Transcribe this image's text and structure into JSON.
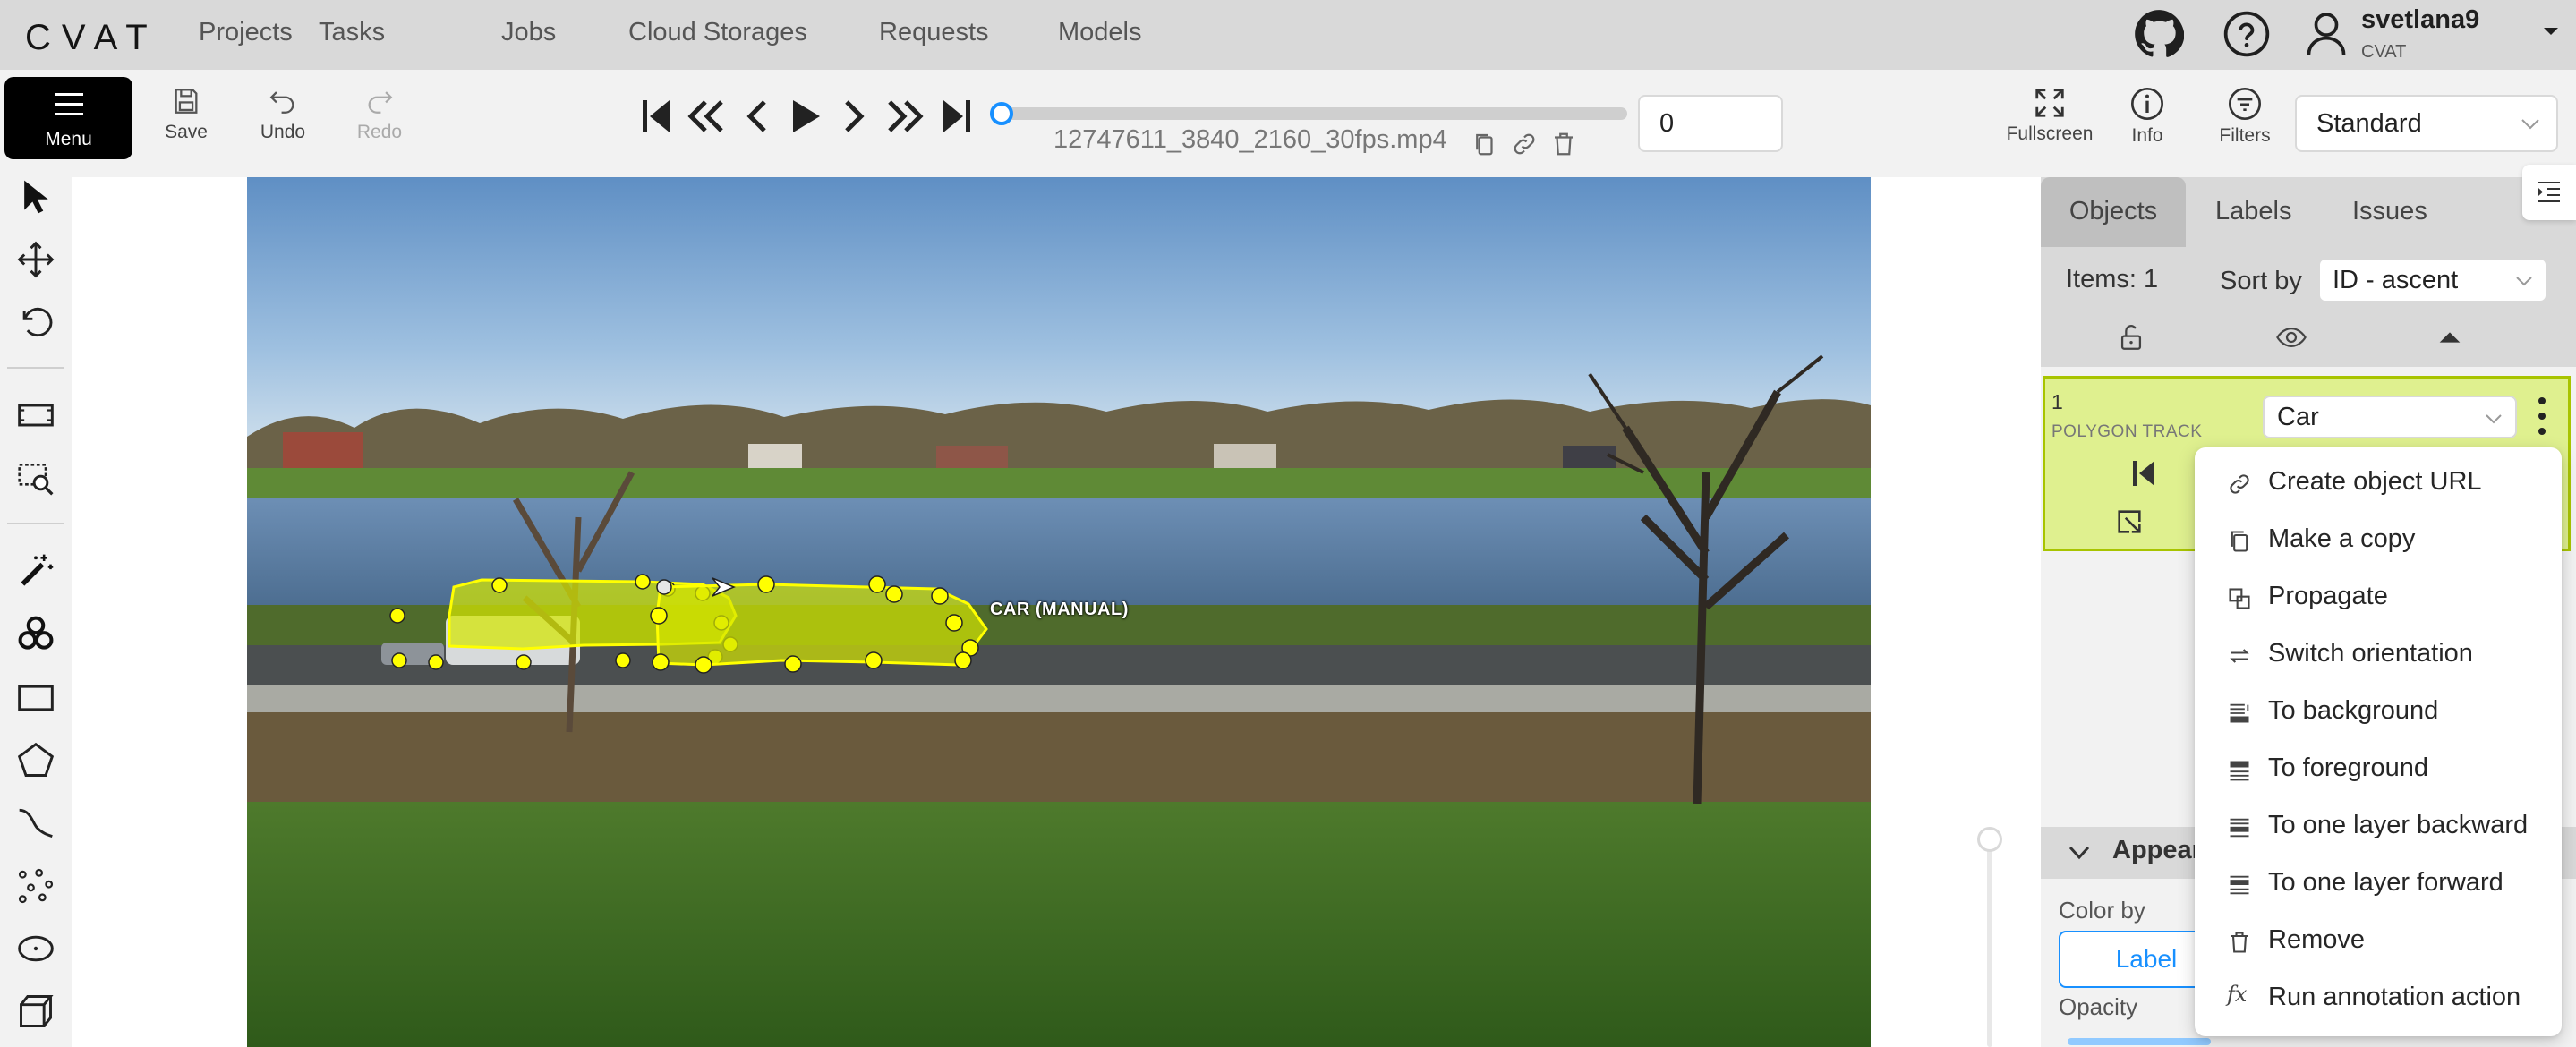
{
  "app": {
    "logo": "CVAT",
    "nav": [
      "Projects",
      "Tasks",
      "Jobs",
      "Cloud Storages",
      "Requests",
      "Models"
    ],
    "user": {
      "name": "svetlana9",
      "org": "CVAT"
    }
  },
  "toolbar": {
    "menu_label": "Menu",
    "save_label": "Save",
    "undo_label": "Undo",
    "redo_label": "Redo",
    "filename": "12747611_3840_2160_30fps.mp4",
    "frame_value": "0",
    "fullscreen_label": "Fullscreen",
    "info_label": "Info",
    "filters_label": "Filters",
    "workspace": "Standard"
  },
  "canvas": {
    "shape_label": "CAR (MANUAL)"
  },
  "sidebar": {
    "tabs": [
      "Objects",
      "Labels",
      "Issues"
    ],
    "items_count": "Items: 1",
    "sort_by_label": "Sort by",
    "sort_by_value": "ID - ascent",
    "object": {
      "id": "1",
      "type": "POLYGON TRACK",
      "label": "Car",
      "color": "#dff08f"
    },
    "appearance": {
      "title": "Appearance",
      "color_by_label": "Color by",
      "color_by_value": "Label",
      "opacity_label": "Opacity"
    }
  },
  "context_menu": {
    "items": [
      {
        "label": "Create object URL",
        "icon": "link-icon"
      },
      {
        "label": "Make a copy",
        "icon": "copy-icon"
      },
      {
        "label": "Propagate",
        "icon": "propagate-icon"
      },
      {
        "label": "Switch orientation",
        "icon": "switch-icon"
      },
      {
        "label": "To background",
        "icon": "to-background-icon"
      },
      {
        "label": "To foreground",
        "icon": "to-foreground-icon"
      },
      {
        "label": "To one layer backward",
        "icon": "layer-backward-icon"
      },
      {
        "label": "To one layer forward",
        "icon": "layer-forward-icon"
      },
      {
        "label": "Remove",
        "icon": "trash-icon"
      },
      {
        "label": "Run annotation action",
        "icon": "function-icon"
      }
    ]
  },
  "colors": {
    "accent": "#1890ff",
    "shape_fill": "#d4e600",
    "shape_point": "#ffff00"
  }
}
